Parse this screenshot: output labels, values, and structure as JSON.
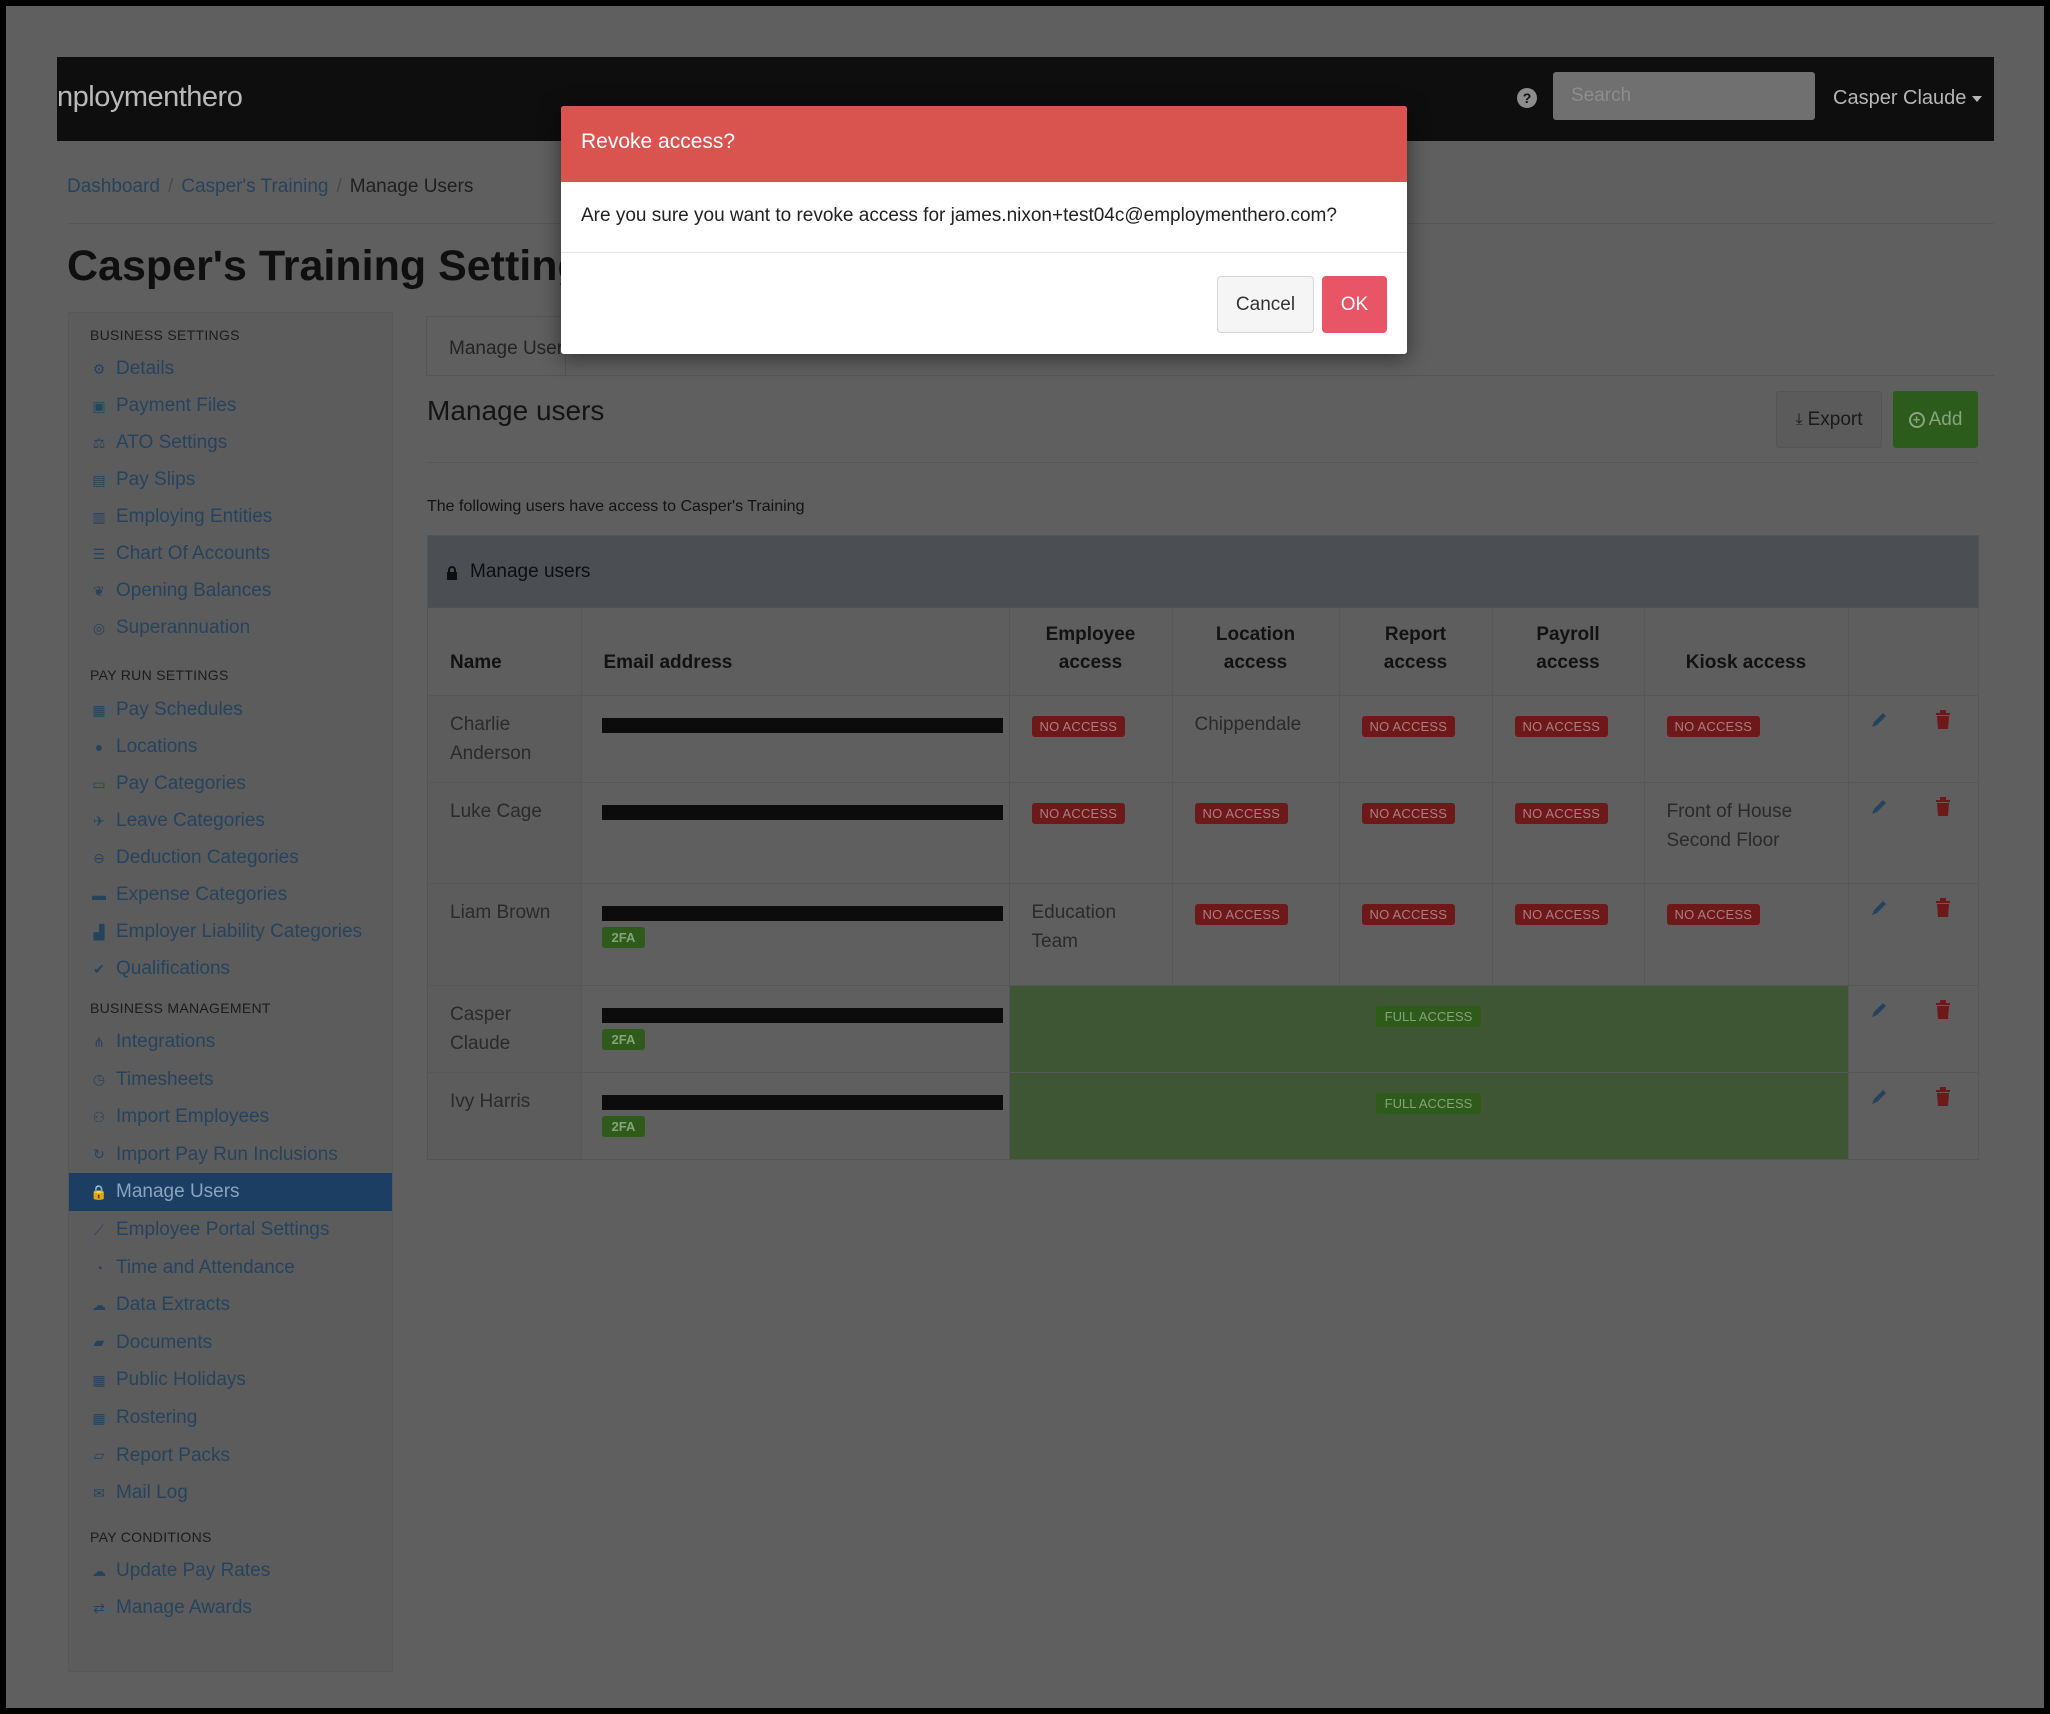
{
  "header": {
    "logo": "nploymenthero",
    "search_placeholder": "Search",
    "user_name": "Casper Claude"
  },
  "breadcrumb": {
    "items": [
      "Dashboard",
      "Casper's Training"
    ],
    "current": "Manage Users"
  },
  "page_title": "Casper's Training Settings",
  "sidebar": {
    "sections": [
      {
        "title": "BUSINESS SETTINGS",
        "items": [
          {
            "label": "Details",
            "icon": "gear-icon"
          },
          {
            "label": "Payment Files",
            "icon": "floppy-icon"
          },
          {
            "label": "ATO Settings",
            "icon": "scales-icon"
          },
          {
            "label": "Pay Slips",
            "icon": "file-icon"
          },
          {
            "label": "Employing Entities",
            "icon": "bank-icon"
          },
          {
            "label": "Chart Of Accounts",
            "icon": "list-icon"
          },
          {
            "label": "Opening Balances",
            "icon": "leaf-icon"
          },
          {
            "label": "Superannuation",
            "icon": "lifebuoy-icon"
          }
        ]
      },
      {
        "title": "PAY RUN SETTINGS",
        "items": [
          {
            "label": "Pay Schedules",
            "icon": "calendar-icon"
          },
          {
            "label": "Locations",
            "icon": "globe-icon"
          },
          {
            "label": "Pay Categories",
            "icon": "money-icon"
          },
          {
            "label": "Leave Categories",
            "icon": "plane-icon"
          },
          {
            "label": "Deduction Categories",
            "icon": "minus-circle-icon"
          },
          {
            "label": "Expense Categories",
            "icon": "inbox-icon"
          },
          {
            "label": "Employer Liability Categories",
            "icon": "bar-chart-icon"
          },
          {
            "label": "Qualifications",
            "icon": "check-icon"
          }
        ]
      },
      {
        "title": "BUSINESS MANAGEMENT",
        "items": [
          {
            "label": "Integrations",
            "icon": "sitemap-icon"
          },
          {
            "label": "Timesheets",
            "icon": "clock-icon"
          },
          {
            "label": "Import Employees",
            "icon": "users-icon"
          },
          {
            "label": "Import Pay Run Inclusions",
            "icon": "refresh-icon"
          },
          {
            "label": "Manage Users",
            "icon": "lock-icon",
            "active": true
          },
          {
            "label": "Employee Portal Settings",
            "icon": "wand-icon"
          },
          {
            "label": "Time and Attendance",
            "icon": "user-clock-icon"
          },
          {
            "label": "Data Extracts",
            "icon": "cloud-download-icon"
          },
          {
            "label": "Documents",
            "icon": "folder-icon"
          },
          {
            "label": "Public Holidays",
            "icon": "calendar-icon"
          },
          {
            "label": "Rostering",
            "icon": "calendar-grid-icon"
          },
          {
            "label": "Report Packs",
            "icon": "folder-open-icon"
          },
          {
            "label": "Mail Log",
            "icon": "envelope-icon"
          }
        ]
      },
      {
        "title": "PAY CONDITIONS",
        "items": [
          {
            "label": "Update Pay Rates",
            "icon": "cloud-upload-icon"
          },
          {
            "label": "Manage Awards",
            "icon": "exchange-icon"
          }
        ]
      }
    ]
  },
  "tabs": {
    "active": "Manage Users"
  },
  "main": {
    "section_title": "Manage users",
    "export_label": "Export",
    "add_label": "Add",
    "intro": "The following users have access to Casper's Training",
    "panel_title": "Manage users"
  },
  "table": {
    "headers": {
      "name": "Name",
      "email": "Email address",
      "employee": [
        "Employee",
        "access"
      ],
      "location": [
        "Location",
        "access"
      ],
      "report": [
        "Report",
        "access"
      ],
      "payroll": [
        "Payroll",
        "access"
      ],
      "kiosk": "Kiosk access"
    },
    "badges": {
      "no_access": "NO ACCESS",
      "full_access": "FULL ACCESS",
      "two_fa": "2FA"
    },
    "rows": [
      {
        "name": [
          "Charlie",
          "Anderson"
        ],
        "two_fa": false,
        "employee": "NO ACCESS",
        "location": "Chippendale",
        "report": "NO ACCESS",
        "payroll": "NO ACCESS",
        "kiosk": "NO ACCESS"
      },
      {
        "name": [
          "Luke Cage"
        ],
        "two_fa": false,
        "employee": "NO ACCESS",
        "location": "NO ACCESS",
        "report": "NO ACCESS",
        "payroll": "NO ACCESS",
        "kiosk": [
          "Front of House",
          "Second Floor"
        ]
      },
      {
        "name": [
          "Liam Brown"
        ],
        "two_fa": true,
        "employee": [
          "Education",
          "Team"
        ],
        "location": "NO ACCESS",
        "report": "NO ACCESS",
        "payroll": "NO ACCESS",
        "kiosk": "NO ACCESS"
      },
      {
        "name": [
          "Casper",
          "Claude"
        ],
        "two_fa": true,
        "full": "FULL ACCESS"
      },
      {
        "name": [
          "Ivy Harris"
        ],
        "two_fa": true,
        "full": "FULL ACCESS"
      }
    ]
  },
  "modal": {
    "title": "Revoke access?",
    "body": "Are you sure you want to revoke access for james.nixon+test04c@employmenthero.com?",
    "cancel_label": "Cancel",
    "ok_label": "OK"
  },
  "colors": {
    "modal_header": "#d9534f",
    "ok_button": "#e85566",
    "badge_no_access": "#6e1919",
    "badge_full_access": "#2e5a1a",
    "active_sidebar": "#1d3e63"
  }
}
